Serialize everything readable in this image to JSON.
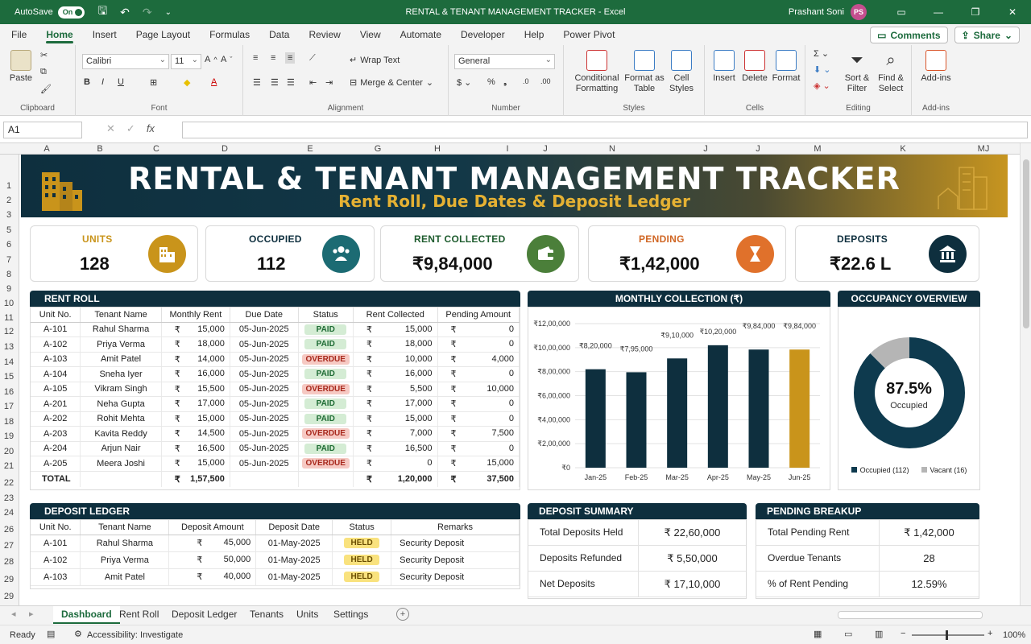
{
  "titlebar": {
    "autosave_label": "AutoSave",
    "autosave_state": "On",
    "doc_title": "RENTAL & TENANT MANAGEMENT TRACKER  -  Excel",
    "user_name": "Prashant Soni",
    "user_initials": "PS"
  },
  "menu": {
    "tabs": [
      "File",
      "Home",
      "Insert",
      "Page Layout",
      "Formulas",
      "Data",
      "Review",
      "View",
      "Automate",
      "Developer",
      "Help",
      "Power Pivot"
    ],
    "active": "Home",
    "comments": "Comments",
    "share": "Share"
  },
  "ribbon": {
    "paste": "Paste",
    "clipboard": "Clipboard",
    "font_name": "Calibri",
    "font_size": "11",
    "font": "Font",
    "wrap_text": "Wrap Text",
    "merge_center": "Merge & Center",
    "alignment": "Alignment",
    "number_format": "General",
    "number": "Number",
    "conditional": "Conditional",
    "formatting": "Formatting",
    "format_as": "Format as",
    "table": "Table",
    "cell": "Cell",
    "cell_styles": "Styles",
    "styles": "Styles",
    "insert": "Insert",
    "delete": "Delete",
    "format": "Format",
    "cells": "Cells",
    "sort": "Sort &",
    "filter": "Filter",
    "find": "Find &",
    "select": "Select",
    "editing": "Editing",
    "addins": "Add-ins",
    "addins_group": "Add-ins"
  },
  "formula_bar": {
    "name_box": "A1",
    "fx": "fx"
  },
  "columns": [
    "A",
    "B",
    "C",
    "D",
    "E",
    "G",
    "H",
    "I",
    "J",
    "N",
    "J",
    "J",
    "M",
    "K",
    "MJ"
  ],
  "rows": [
    "1",
    "2",
    "3",
    "5",
    "6",
    "7",
    "8",
    "9",
    "10",
    "11",
    "12",
    "13",
    "14",
    "15",
    "16",
    "17",
    "18",
    "19",
    "20",
    "21",
    "22",
    "23",
    "24",
    "26",
    "27",
    "28",
    "29",
    "29"
  ],
  "banner": {
    "title": "RENTAL & TENANT MANAGEMENT TRACKER",
    "subtitle": "Rent Roll, Due Dates & Deposit Ledger"
  },
  "kpis": [
    {
      "label": "UNITS",
      "value": "128",
      "color": "#c9941b",
      "icon": "building-icon"
    },
    {
      "label": "OCCUPIED",
      "value": "112",
      "color": "#1c6b73",
      "icon": "people-icon"
    },
    {
      "label": "RENT COLLECTED",
      "value": "₹9,84,000",
      "color": "#4b7f3a",
      "icon": "wallet-icon"
    },
    {
      "label": "PENDING",
      "value": "₹1,42,000",
      "color": "#e0712b",
      "icon": "hourglass-icon"
    },
    {
      "label": "DEPOSITS",
      "value": "₹22.6 L",
      "color": "#0e2f3e",
      "icon": "bank-icon"
    }
  ],
  "rent_roll": {
    "title": "RENT ROLL",
    "headers": [
      "Unit No.",
      "Tenant Name",
      "Monthly Rent",
      "Due Date",
      "Status",
      "Rent Collected",
      "Pending Amount"
    ],
    "currency": "₹",
    "rows": [
      {
        "unit": "A-101",
        "tenant": "Rahul Sharma",
        "rent": "15,000",
        "due": "05-Jun-2025",
        "status": "PAID",
        "collected": "15,000",
        "pending": "0"
      },
      {
        "unit": "A-102",
        "tenant": "Priya Verma",
        "rent": "18,000",
        "due": "05-Jun-2025",
        "status": "PAID",
        "collected": "18,000",
        "pending": "0"
      },
      {
        "unit": "A-103",
        "tenant": "Amit Patel",
        "rent": "14,000",
        "due": "05-Jun-2025",
        "status": "OVERDUE",
        "collected": "10,000",
        "pending": "4,000"
      },
      {
        "unit": "A-104",
        "tenant": "Sneha Iyer",
        "rent": "16,000",
        "due": "05-Jun-2025",
        "status": "PAID",
        "collected": "16,000",
        "pending": "0"
      },
      {
        "unit": "A-105",
        "tenant": "Vikram Singh",
        "rent": "15,500",
        "due": "05-Jun-2025",
        "status": "OVERDUE",
        "collected": "5,500",
        "pending": "10,000"
      },
      {
        "unit": "A-201",
        "tenant": "Neha Gupta",
        "rent": "17,000",
        "due": "05-Jun-2025",
        "status": "PAID",
        "collected": "17,000",
        "pending": "0"
      },
      {
        "unit": "A-202",
        "tenant": "Rohit Mehta",
        "rent": "15,000",
        "due": "05-Jun-2025",
        "status": "PAID",
        "collected": "15,000",
        "pending": "0"
      },
      {
        "unit": "A-203",
        "tenant": "Kavita Reddy",
        "rent": "14,500",
        "due": "05-Jun-2025",
        "status": "OVERDUE",
        "collected": "7,000",
        "pending": "7,500"
      },
      {
        "unit": "A-204",
        "tenant": "Arjun Nair",
        "rent": "16,500",
        "due": "05-Jun-2025",
        "status": "PAID",
        "collected": "16,500",
        "pending": "0"
      },
      {
        "unit": "A-205",
        "tenant": "Meera Joshi",
        "rent": "15,000",
        "due": "05-Jun-2025",
        "status": "OVERDUE",
        "collected": "0",
        "pending": "15,000"
      }
    ],
    "total_label": "TOTAL",
    "total_rent": "1,57,500",
    "total_collected": "1,20,000",
    "total_pending": "37,500"
  },
  "monthly_title": "MONTHLY COLLECTION (₹)",
  "chart_data": {
    "type": "bar",
    "title": "MONTHLY COLLECTION (₹)",
    "categories": [
      "Jan-25",
      "Feb-25",
      "Mar-25",
      "Apr-25",
      "May-25",
      "Jun-25"
    ],
    "values": [
      820000,
      795000,
      910000,
      1020000,
      984000,
      984000
    ],
    "data_labels": [
      "₹8,20,000",
      "₹7,95,000",
      "₹9,10,000",
      "₹10,20,000",
      "₹9,84,000",
      "₹9,84,000"
    ],
    "y_ticks": [
      "₹0",
      "₹2,00,000",
      "₹4,00,000",
      "₹6,00,000",
      "₹8,00,000",
      "₹10,00,000",
      "₹12,00,000"
    ],
    "ylim": [
      0,
      1200000
    ],
    "bar_color": "#0e2f3e",
    "highlight_color": "#c9941b",
    "highlight_index": 5,
    "grid": true
  },
  "occupancy": {
    "title": "OCCUPANCY OVERVIEW",
    "percent_label": "87.5%",
    "sub": "Occupied",
    "occupied": 112,
    "vacant": 16,
    "legend_occupied": "Occupied (112)",
    "legend_vacant": "Vacant (16)",
    "occupied_color": "#0e3a4e",
    "vacant_color": "#b5b5b5"
  },
  "deposit_ledger": {
    "title": "DEPOSIT LEDGER",
    "headers": [
      "Unit No.",
      "Tenant Name",
      "Deposit Amount",
      "Deposit Date",
      "Status",
      "Remarks"
    ],
    "rows": [
      {
        "unit": "A-101",
        "tenant": "Rahul Sharma",
        "amount": "45,000",
        "date": "01-May-2025",
        "status": "HELD",
        "remarks": "Security Deposit"
      },
      {
        "unit": "A-102",
        "tenant": "Priya Verma",
        "amount": "50,000",
        "date": "01-May-2025",
        "status": "HELD",
        "remarks": "Security Deposit"
      },
      {
        "unit": "A-103",
        "tenant": "Amit Patel",
        "amount": "40,000",
        "date": "01-May-2025",
        "status": "HELD",
        "remarks": "Security Deposit"
      }
    ]
  },
  "deposit_summary": {
    "title": "DEPOSIT SUMMARY",
    "rows": [
      {
        "label": "Total Deposits Held",
        "value": "₹ 22,60,000"
      },
      {
        "label": "Deposits Refunded",
        "value": "₹ 5,50,000"
      },
      {
        "label": "Net Deposits",
        "value": "₹ 17,10,000"
      }
    ]
  },
  "pending_breakup": {
    "title": "PENDING BREAKUP",
    "rows": [
      {
        "label": "Total Pending Rent",
        "value": "₹ 1,42,000"
      },
      {
        "label": "Overdue Tenants",
        "value": "28"
      },
      {
        "label": "% of Rent Pending",
        "value": "12.59%"
      }
    ]
  },
  "sheet_tabs": [
    "Dashboard",
    "Rent Roll",
    "Deposit Ledger",
    "Tenants",
    "Units",
    "Settings"
  ],
  "active_sheet": "Dashboard",
  "status": {
    "ready": "Ready",
    "accessibility": "Accessibility: Investigate",
    "zoom": "100%"
  }
}
